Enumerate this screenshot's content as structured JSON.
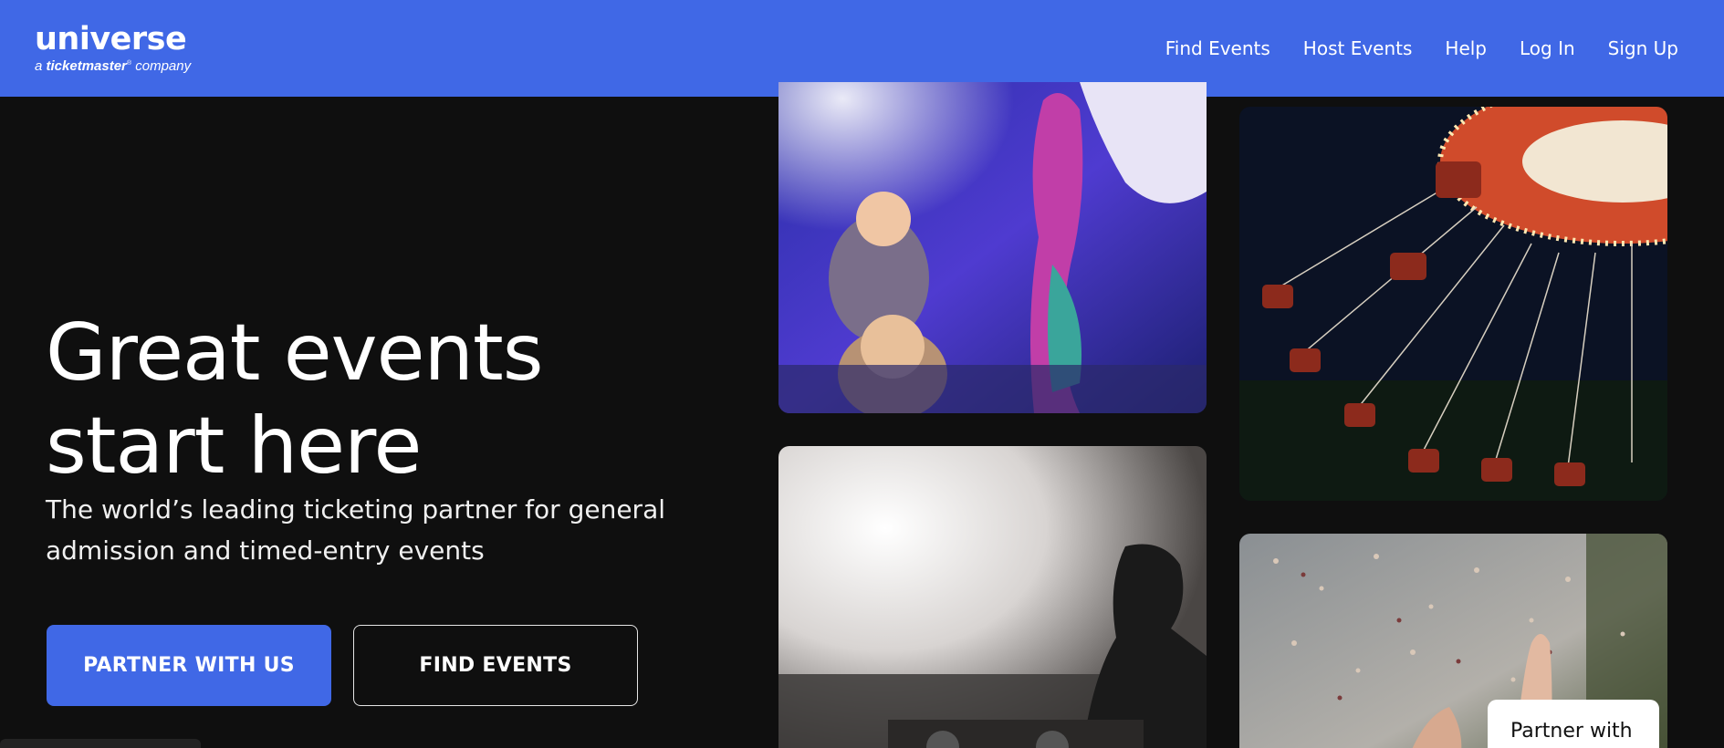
{
  "header": {
    "logo_word": "universe",
    "logo_tagline_prefix": "a",
    "logo_tagline_brand": "ticketmaster",
    "logo_tagline_suffix": "company",
    "nav": [
      "Find Events",
      "Host Events",
      "Help",
      "Log In",
      "Sign Up"
    ],
    "background_color": "#4068e6"
  },
  "hero": {
    "title": "Great events\nstart here",
    "subtitle": "The world’s leading ticketing partner for general admission and timed-entry events",
    "primary_button": "PARTNER WITH US",
    "secondary_button": "FIND EVENTS"
  },
  "gallery": {
    "images": [
      "mermaid-show-crowd-photo",
      "swing-ride-at-night-photo",
      "dj-concert-photo",
      "confetti-crowd-photo"
    ]
  },
  "floating_button": "Partner with us"
}
